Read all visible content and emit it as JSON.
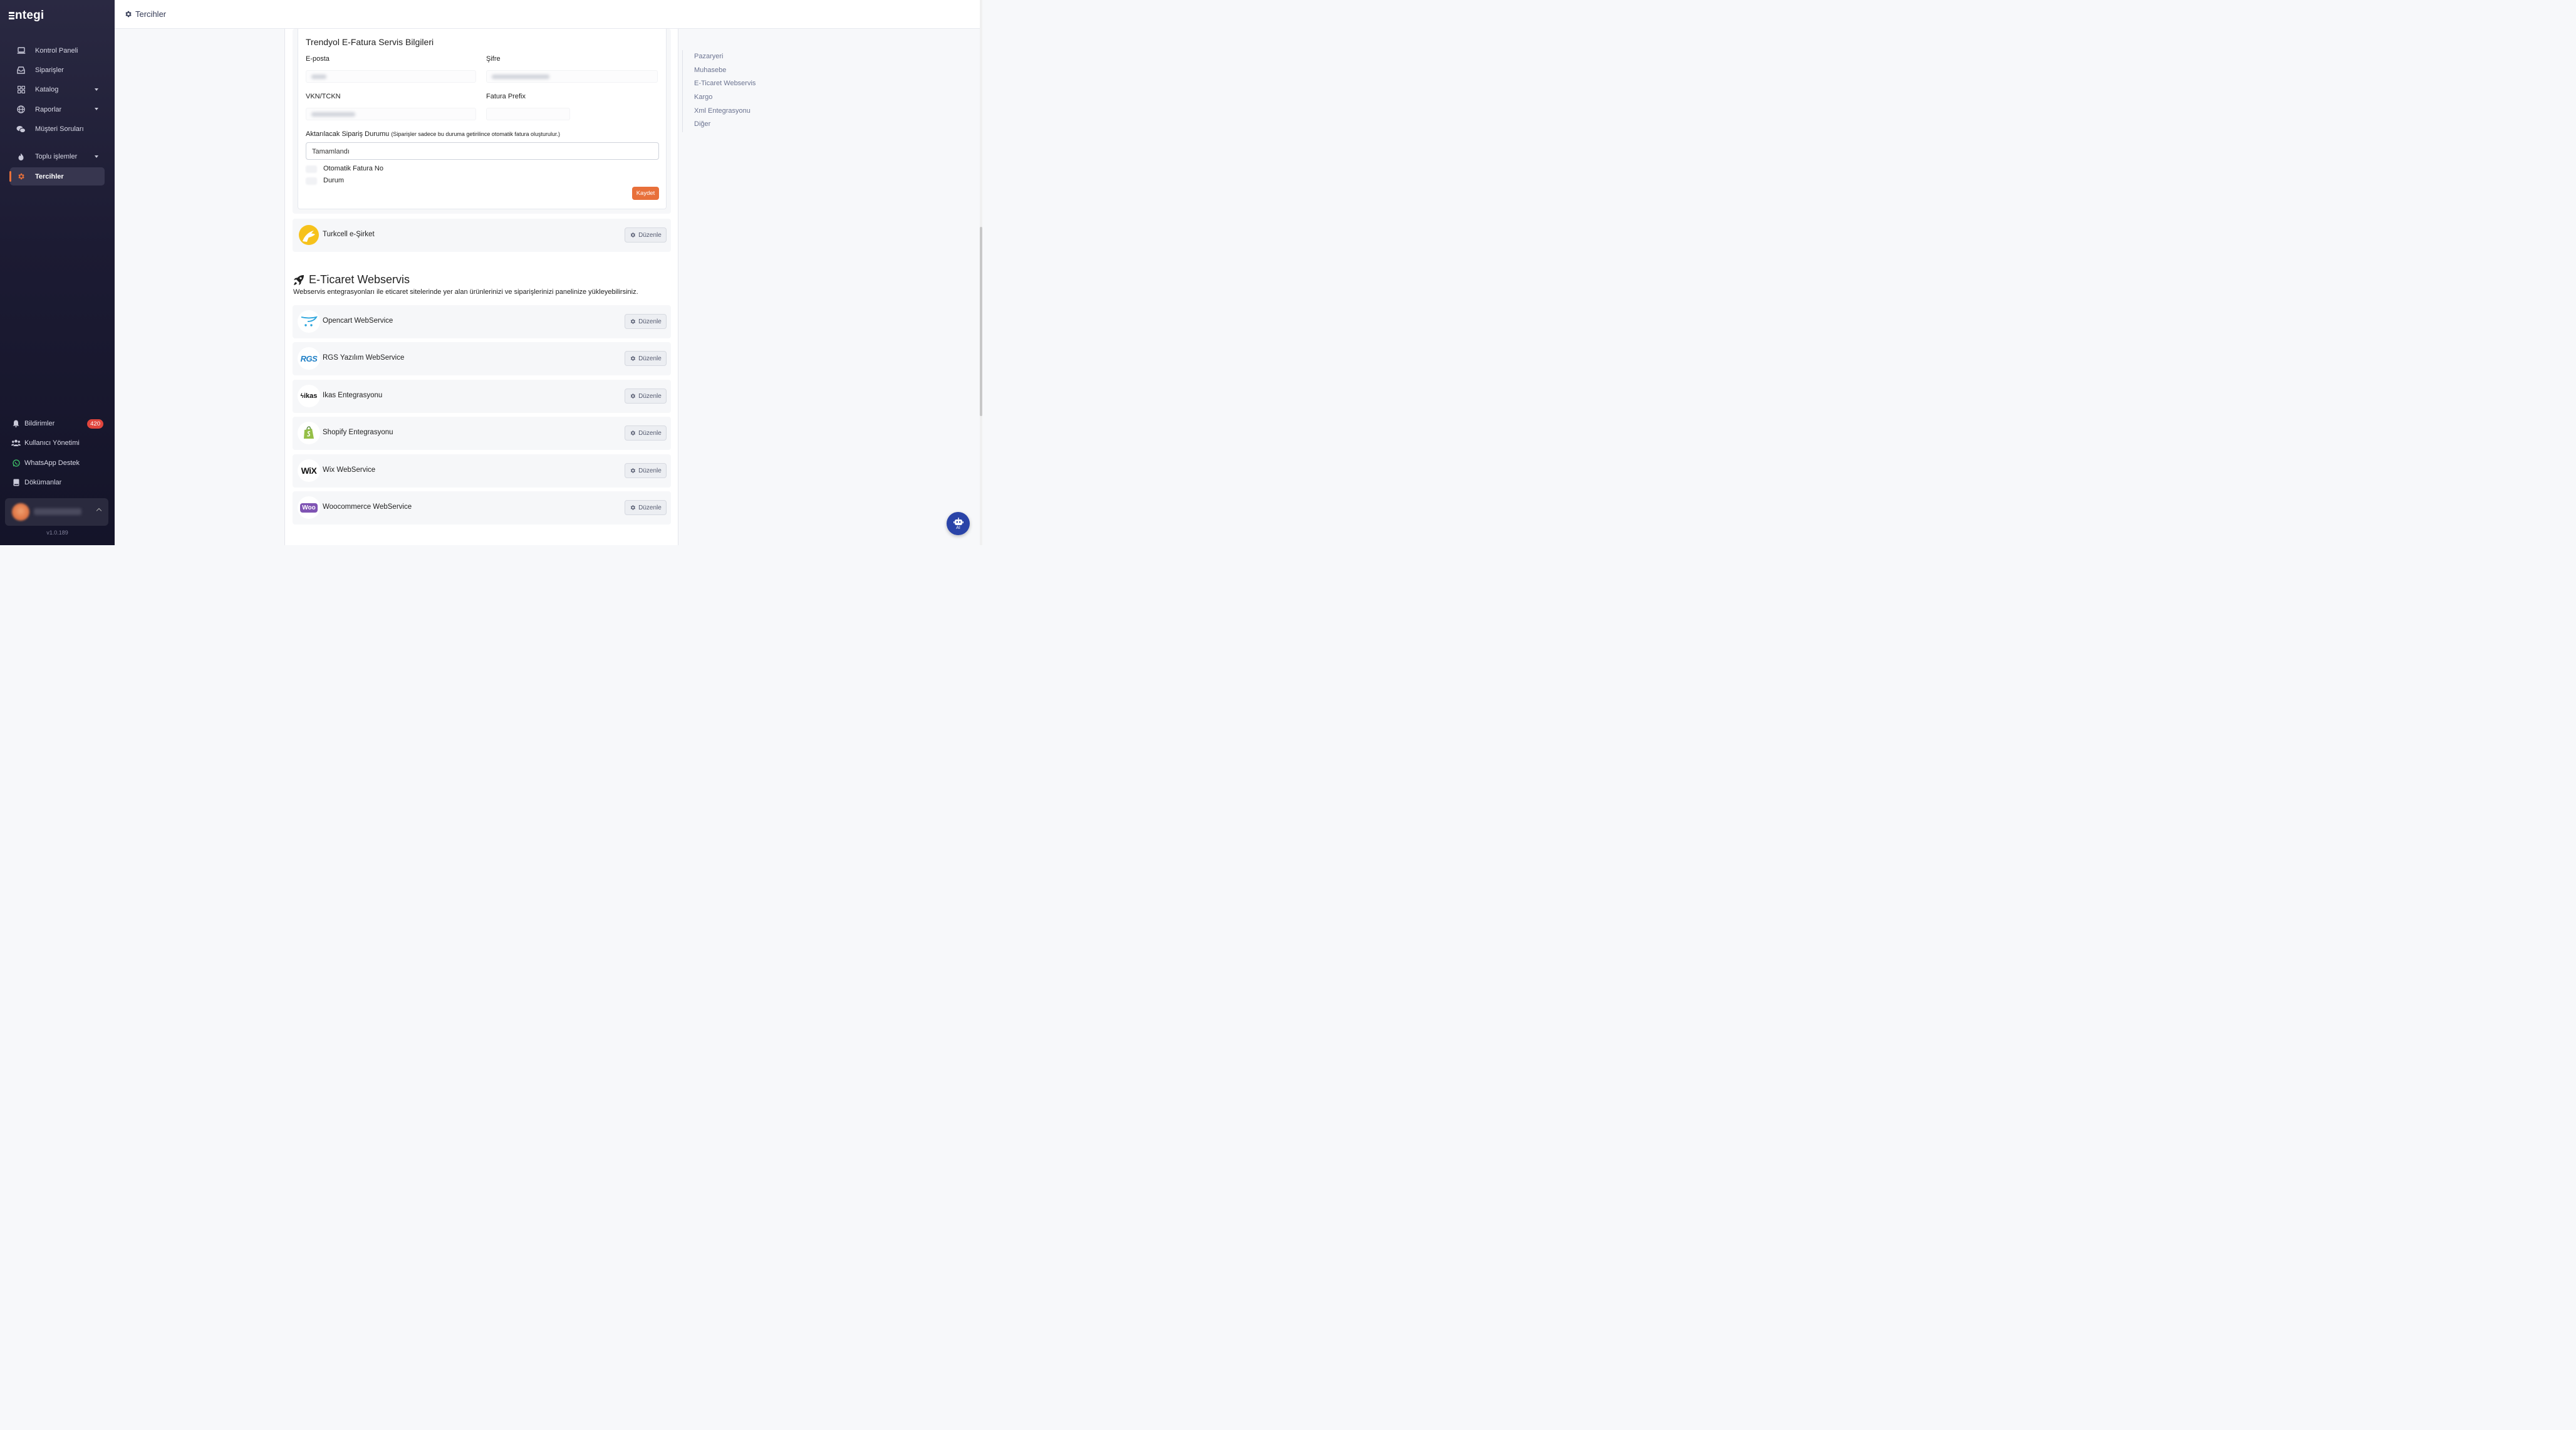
{
  "app": {
    "logo_text": "ntegi"
  },
  "sidebar": {
    "items": [
      {
        "label": "Kontrol Paneli",
        "icon": "laptop-icon"
      },
      {
        "label": "Siparişler",
        "icon": "inbox-icon"
      },
      {
        "label": "Katalog",
        "icon": "grid-icon",
        "has_caret": true
      },
      {
        "label": "Raporlar",
        "icon": "globe-icon",
        "has_caret": true
      },
      {
        "label": "Müşteri Soruları",
        "icon": "chat-icon"
      },
      {
        "label": "Toplu işlemler",
        "icon": "fire-icon",
        "has_caret": true
      },
      {
        "label": "Tercihler",
        "icon": "gear-icon",
        "active": true
      }
    ],
    "bottom": [
      {
        "label": "Bildirimler",
        "icon": "bell-icon",
        "badge": "420"
      },
      {
        "label": "Kullanıcı Yönetimi",
        "icon": "users-icon"
      },
      {
        "label": "WhatsApp Destek",
        "icon": "whatsapp-icon"
      },
      {
        "label": "Dökümanlar",
        "icon": "book-icon"
      }
    ],
    "version": "v1.0.189",
    "accent": "#e8703a"
  },
  "header": {
    "title": "Tercihler"
  },
  "efatura": {
    "title": "Trendyol E-Fatura Servis Bilgileri",
    "email_label": "E-posta",
    "password_label": "Şifre",
    "vkn_label": "VKN/TCKN",
    "prefix_label": "Fatura Prefix",
    "status_label": "Aktarılacak Sipariş Durumu",
    "status_note": "(Siparişler sadece bu duruma getirilince otomatik fatura oluşturulur.)",
    "status_value": "Tamamlandı",
    "auto_invoice_label": "Otomatik Fatura No",
    "state_label": "Durum",
    "save_label": "Kaydet"
  },
  "turkcell": {
    "name": "Turkcell e-Şirket",
    "edit_label": "Düzenle"
  },
  "webservice": {
    "title": "E-Ticaret Webservis",
    "description": "Webservis entegrasyonları ile eticaret sitelerinde yer alan ürünlerinizi ve siparişlerinizi panelinize yükleyebilirsiniz.",
    "items": [
      {
        "name": "Opencart WebService",
        "logo": "opencart-logo",
        "edit_label": "Düzenle"
      },
      {
        "name": "RGS Yazılım WebService",
        "logo": "rgs-logo",
        "logo_text": "RGS",
        "edit_label": "Düzenle"
      },
      {
        "name": "Ikas Entegrasyonu",
        "logo": "ikas-logo",
        "logo_text": "ikas",
        "edit_label": "Düzenle"
      },
      {
        "name": "Shopify Entegrasyonu",
        "logo": "shopify-logo",
        "edit_label": "Düzenle"
      },
      {
        "name": "Wix WebService",
        "logo": "wix-logo",
        "logo_text": "WiX",
        "edit_label": "Düzenle"
      },
      {
        "name": "Woocommerce WebService",
        "logo": "woo-logo",
        "logo_text": "Woo",
        "edit_label": "Düzenle"
      }
    ]
  },
  "toc": [
    "Pazaryeri",
    "Muhasebe",
    "E-Ticaret Webservis",
    "Kargo",
    "Xml Entegrasyonu",
    "Diğer"
  ],
  "ai_button": {
    "label": "AI"
  }
}
